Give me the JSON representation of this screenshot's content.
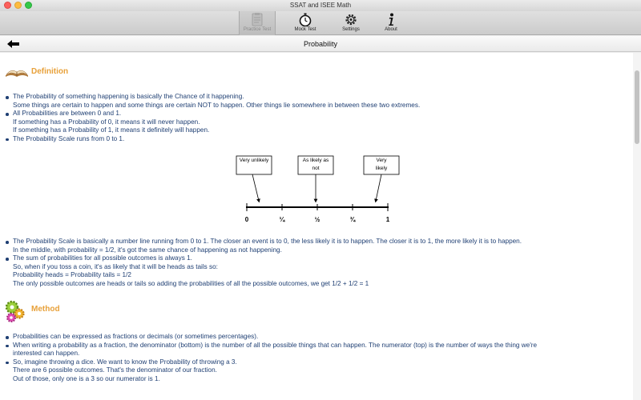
{
  "window": {
    "title": "SSAT and ISEE Math"
  },
  "toolbar": {
    "practice_test": "Practice Test",
    "mock_test": "Mock Test",
    "settings": "Settings",
    "about": "About"
  },
  "nav": {
    "title": "Probability"
  },
  "definition": {
    "heading": "Definition",
    "bullets": [
      [
        "The Probability of something happening is basically the Chance of it happening.",
        "Some things are certain to happen and some things are certain NOT to happen. Other things lie somewhere in between these two extremes."
      ],
      [
        "All Probabilities are between 0 and 1.",
        "If something has a Probability of 0, it means it will never happen.",
        "If something has a Probability of 1, it means it definitely will happen."
      ],
      [
        "The Probability Scale runs from 0 to 1."
      ]
    ]
  },
  "scale": {
    "labels": [
      "Very unlikely",
      "As likely as not",
      "Very likely"
    ],
    "ticks": [
      "0",
      "¼",
      "½",
      "¾",
      "1"
    ]
  },
  "definition_more": {
    "bullets": [
      [
        "The Probability Scale is basically a number line running from 0 to 1. The closer an event is to 0, the less likely it is to happen. The closer it is to 1, the more likely it is to happen.",
        "In the middle, with probability = 1/2, it's got the same chance of happening as not happening."
      ],
      [
        "The sum of probabilities for all possible outcomes is always 1.",
        "So, when if you toss a coin, it's as likely that it will be heads as tails so:",
        "Probability heads = Probability tails = 1/2",
        "The only possible outcomes are heads or tails so adding the probabilities of all the possible outcomes, we get 1/2 + 1/2 = 1"
      ]
    ]
  },
  "method": {
    "heading": "Method",
    "bullets": [
      [
        "Probabilities can be expressed as fractions or decimals (or sometimes percentages)."
      ],
      [
        "When writing a probability as a fraction, the denominator (bottom) is the number of all the possible things that can happen. The numerator (top) is the number of ways the thing we're",
        "interested can happen."
      ],
      [
        "So, imagine throwing a dice. We want to know the Probability of throwing a 3.",
        "There are 6 possible outcomes. That's the denominator of our fraction.",
        "Out of those, only one is a 3 so our numerator is 1."
      ]
    ]
  }
}
